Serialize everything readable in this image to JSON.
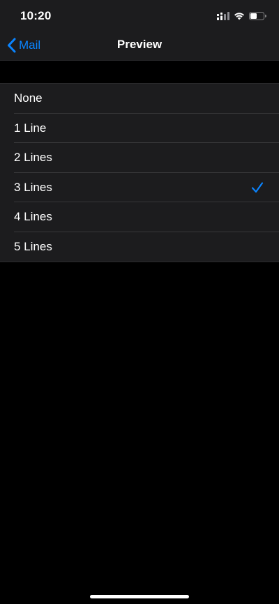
{
  "status_bar": {
    "time": "10:20",
    "icons": [
      "cellular-signal-icon",
      "wifi-icon",
      "battery-icon"
    ]
  },
  "nav": {
    "back_label": "Mail",
    "title": "Preview"
  },
  "options": [
    {
      "label": "None",
      "selected": false
    },
    {
      "label": "1 Line",
      "selected": false
    },
    {
      "label": "2 Lines",
      "selected": false
    },
    {
      "label": "3 Lines",
      "selected": true
    },
    {
      "label": "4 Lines",
      "selected": false
    },
    {
      "label": "5 Lines",
      "selected": false
    }
  ],
  "colors": {
    "accent": "#0a84ff",
    "background": "#000000",
    "grouped_cell": "#1c1c1e",
    "separator": "#38383a"
  }
}
